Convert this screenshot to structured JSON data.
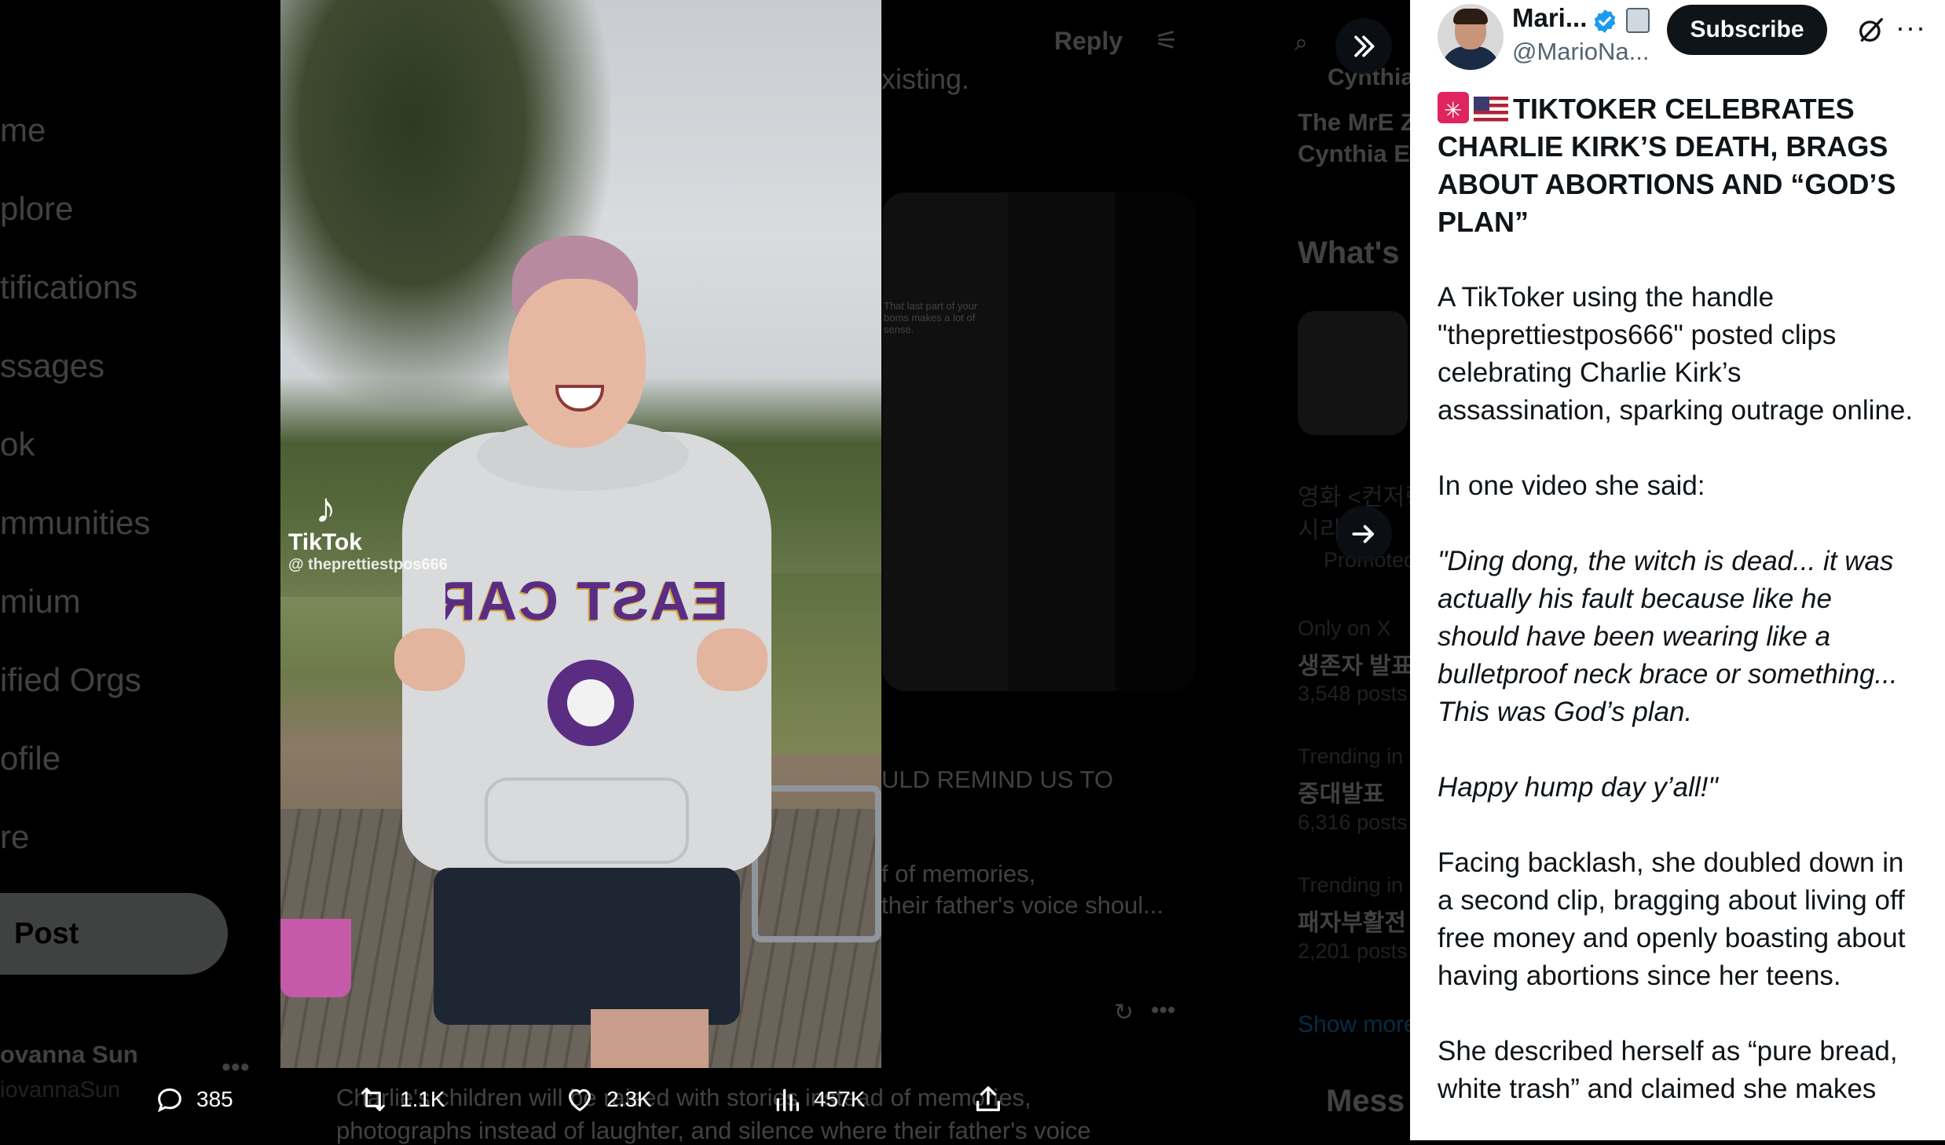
{
  "background": {
    "nav_items": [
      "me",
      "plore",
      "tifications",
      "ssages",
      "ok",
      "mmunities",
      "mium",
      "ified Orgs",
      "ofile",
      "re"
    ],
    "post_button": "Post",
    "account_name": "ovanna Sun",
    "account_handle": "iovannaSun",
    "reply_label": "Reply",
    "timeline_snippet_1": "xisting.",
    "card_overlay_text": "That last part of your boms makes a lot of sense.",
    "timeline_snippet_2": "ULD REMIND US TO",
    "timeline_snippet_3": "f of memories,",
    "timeline_snippet_4": "their father's voice shoul...",
    "timeline_snippet_5": "Charlie's children will be raised with stories instead of memories,",
    "timeline_snippet_6": "photographs instead of laughter, and silence where their father's voice",
    "sidebar_1": "Cynthia",
    "sidebar_2": "The MrE Z",
    "sidebar_3": "Cynthia E",
    "sidebar_heading": "What's",
    "sidebar_korean_1": "영화 <컨저링",
    "sidebar_korean_2": "시리",
    "sidebar_promoted": "Promoted",
    "sidebar_only_on_x": "Only on X",
    "sidebar_korean_3": "생존자 발표",
    "sidebar_posts_1": "3,548 posts",
    "sidebar_trending_1": "Trending in",
    "sidebar_korean_4": "중대발표",
    "sidebar_posts_2": "6,316 posts",
    "sidebar_trending_2": "Trending in",
    "sidebar_korean_5": "패자부활전",
    "sidebar_posts_3": "2,201 posts",
    "sidebar_show_more": "Show more",
    "messages_label": "Mess"
  },
  "video": {
    "watermark_app": "TikTok",
    "watermark_handle": "@ theprettiestpos666",
    "hoodie_text": "EAST CAROLINA"
  },
  "controls": {
    "collapse_icon": "chevrons-right-icon",
    "next_icon": "arrow-right-icon"
  },
  "actions": {
    "replies": "385",
    "reposts": "1.1K",
    "likes": "2.3K",
    "views": "457K"
  },
  "panel": {
    "author_name": "Mari...",
    "author_handle": "@MarioNa...",
    "subscribe_label": "Subscribe",
    "headline": "TIKTOKER CELEBRATES CHARLIE KIRK’S DEATH, BRAGS ABOUT ABORTIONS AND “GOD’S PLAN”",
    "para1": "A TikToker using the handle \"theprettiestpos666\" posted clips celebrating Charlie Kirk’s assassination, sparking outrage online.",
    "para2": "In one video she said:",
    "quote1": " \"Ding dong, the witch is dead... it was actually his fault because like he should have been wearing like a bulletproof neck brace or something... This was God’s plan.",
    "quote2": "Happy hump day y’all!\"",
    "para3": "Facing backlash, she doubled down in a second clip, bragging about living off free money and openly boasting about having abortions since her teens.",
    "para4": "She described herself as “pure bread, white trash” and claimed she makes"
  },
  "colors": {
    "accent_verified": "#1d9bf0",
    "panel_bg": "#ffffff",
    "backdrop": "#000000"
  }
}
